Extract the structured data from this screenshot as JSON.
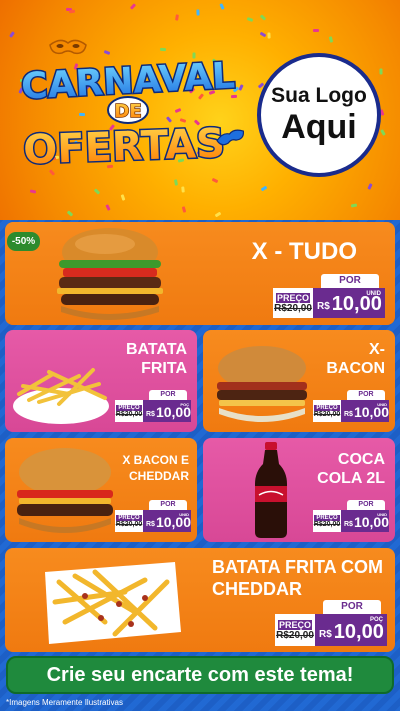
{
  "header": {
    "title_line1": "CARNAVAL",
    "title_line2": "DE",
    "title_line3": "OFERTAS",
    "logo_line1": "Sua Logo",
    "logo_line2": "Aqui"
  },
  "products": [
    {
      "name": "X - TUDO",
      "badge": "-50%",
      "old_label": "PREÇO",
      "old_price": "R$20,00",
      "por": "POR",
      "currency": "R$",
      "price": "10,00",
      "unit": "UNID"
    },
    {
      "name_l1": "BATATA",
      "name_l2": "FRITA",
      "old_label": "PREÇO",
      "old_price": "R$20,00",
      "por": "POR",
      "currency": "R$",
      "price": "10,00",
      "unit": "POÇ"
    },
    {
      "name_l1": "X-",
      "name_l2": "BACON",
      "old_label": "PREÇO",
      "old_price": "R$20,00",
      "por": "POR",
      "currency": "R$",
      "price": "10,00",
      "unit": "UNID"
    },
    {
      "name_l1": "X BACON E",
      "name_l2": "CHEDDAR",
      "old_label": "PREÇO",
      "old_price": "R$20,00",
      "por": "POR",
      "currency": "R$",
      "price": "10,00",
      "unit": "UNID"
    },
    {
      "name_l1": "COCA",
      "name_l2": "COLA 2L",
      "old_label": "PREÇO",
      "old_price": "R$20,00",
      "por": "POR",
      "currency": "R$",
      "price": "10,00",
      "unit": "UNID"
    },
    {
      "name_l1": "BATATA FRITA COM",
      "name_l2": "CHEDDAR",
      "old_label": "PREÇO",
      "old_price": "R$20,00",
      "por": "POR",
      "currency": "R$",
      "price": "10,00",
      "unit": "POÇ"
    }
  ],
  "cta": "Crie seu encarte com este tema!",
  "footnote": "*Imagens Meramente Ilustrativas",
  "colors": {
    "orange": "#f07a10",
    "pink": "#d84896",
    "purple": "#6a2b8f",
    "green": "#1f8a3d",
    "blue": "#1f63c9"
  }
}
